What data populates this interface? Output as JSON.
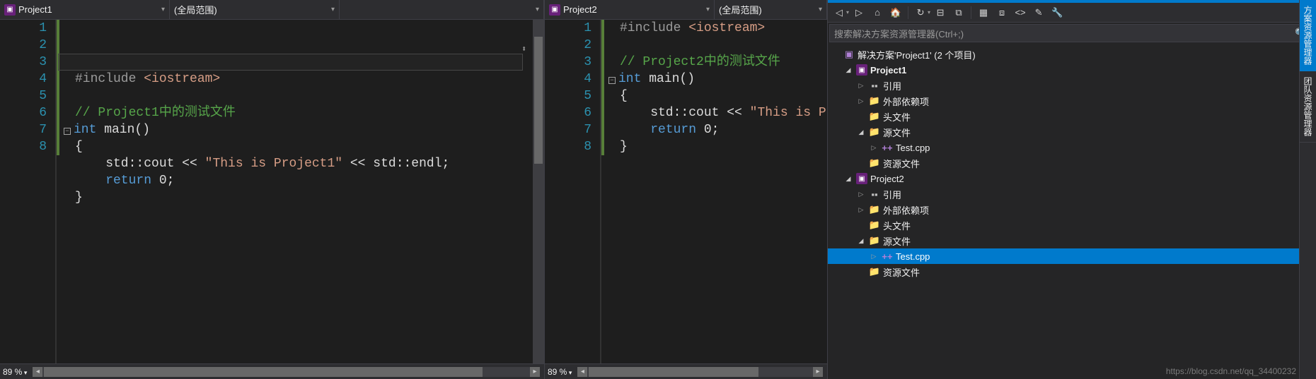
{
  "editors": [
    {
      "nav": {
        "project": "Project1",
        "scope": "(全局范围)"
      },
      "highlight_line": 3,
      "greenbar": {
        "from": 1,
        "to": 8
      },
      "lines": [
        {
          "n": 1,
          "tokens": [
            [
              "pp",
              "#include "
            ],
            [
              "str",
              "<iostream>"
            ]
          ]
        },
        {
          "n": 2,
          "tokens": []
        },
        {
          "n": 3,
          "tokens": [
            [
              "cmt",
              "// Project1中的测试文件"
            ]
          ]
        },
        {
          "n": 4,
          "tokens": [
            [
              "kw",
              "int"
            ],
            [
              "ident",
              " main()"
            ]
          ],
          "outline": "-"
        },
        {
          "n": 5,
          "tokens": [
            [
              "ident",
              "{"
            ]
          ]
        },
        {
          "n": 6,
          "tokens": [
            [
              "ident",
              "    std::cout << "
            ],
            [
              "str",
              "\"This is Project1\""
            ],
            [
              "ident",
              " << std::endl;"
            ]
          ]
        },
        {
          "n": 7,
          "tokens": [
            [
              "kw",
              "    return"
            ],
            [
              "ident",
              " 0;"
            ]
          ]
        },
        {
          "n": 8,
          "tokens": [
            [
              "ident",
              "}"
            ]
          ]
        }
      ],
      "zoom": "89 %",
      "hthumb_width": 620
    },
    {
      "nav": {
        "project": "Project2",
        "scope": "(全局范围)"
      },
      "highlight_line": 0,
      "greenbar": {
        "from": 1,
        "to": 8
      },
      "lines": [
        {
          "n": 1,
          "tokens": [
            [
              "pp",
              "#include "
            ],
            [
              "str",
              "<iostream>"
            ]
          ]
        },
        {
          "n": 2,
          "tokens": []
        },
        {
          "n": 3,
          "tokens": [
            [
              "cmt",
              "// Project2中的测试文件"
            ]
          ]
        },
        {
          "n": 4,
          "tokens": [
            [
              "kw",
              "int"
            ],
            [
              "ident",
              " main()"
            ]
          ],
          "outline": "-"
        },
        {
          "n": 5,
          "tokens": [
            [
              "ident",
              "{"
            ]
          ]
        },
        {
          "n": 6,
          "tokens": [
            [
              "ident",
              "    std::cout << "
            ],
            [
              "str",
              "\"This is P"
            ]
          ]
        },
        {
          "n": 7,
          "tokens": [
            [
              "kw",
              "    return"
            ],
            [
              "ident",
              " 0;"
            ]
          ]
        },
        {
          "n": 8,
          "tokens": [
            [
              "ident",
              "}"
            ]
          ]
        }
      ],
      "zoom": "89 %",
      "hthumb_width": 240
    }
  ],
  "solution_explorer": {
    "search_placeholder": "搜索解决方案资源管理器(Ctrl+;)",
    "toolbar_icons": [
      "back",
      "fwd",
      "home",
      "sync",
      "sep",
      "refresh",
      "collapse",
      "copy",
      "sep",
      "showall",
      "properties",
      "code",
      "props",
      "wrench"
    ],
    "tree": [
      {
        "d": 0,
        "tw": "none",
        "icon": "sol",
        "label": "解决方案'Project1' (2 个项目)"
      },
      {
        "d": 1,
        "tw": "expanded",
        "icon": "proj",
        "label": "Project1",
        "bold": true
      },
      {
        "d": 2,
        "tw": "collapsed",
        "icon": "ref",
        "label": "引用"
      },
      {
        "d": 2,
        "tw": "collapsed",
        "icon": "folder-ext",
        "label": "外部依赖项"
      },
      {
        "d": 2,
        "tw": "none",
        "icon": "folder",
        "label": "头文件"
      },
      {
        "d": 2,
        "tw": "expanded",
        "icon": "folder",
        "label": "源文件"
      },
      {
        "d": 3,
        "tw": "collapsed",
        "icon": "cpp",
        "label": "Test.cpp"
      },
      {
        "d": 2,
        "tw": "none",
        "icon": "folder",
        "label": "资源文件"
      },
      {
        "d": 1,
        "tw": "expanded",
        "icon": "proj",
        "label": "Project2"
      },
      {
        "d": 2,
        "tw": "collapsed",
        "icon": "ref",
        "label": "引用"
      },
      {
        "d": 2,
        "tw": "collapsed",
        "icon": "folder-ext",
        "label": "外部依赖项"
      },
      {
        "d": 2,
        "tw": "none",
        "icon": "folder",
        "label": "头文件"
      },
      {
        "d": 2,
        "tw": "expanded",
        "icon": "folder",
        "label": "源文件"
      },
      {
        "d": 3,
        "tw": "collapsed",
        "icon": "cpp",
        "label": "Test.cpp",
        "selected": true
      },
      {
        "d": 2,
        "tw": "none",
        "icon": "folder",
        "label": "资源文件"
      }
    ],
    "side_tabs": [
      "方案资源管理器",
      "团队资源管理器"
    ]
  },
  "watermark": "https://blog.csdn.net/qq_34400232"
}
